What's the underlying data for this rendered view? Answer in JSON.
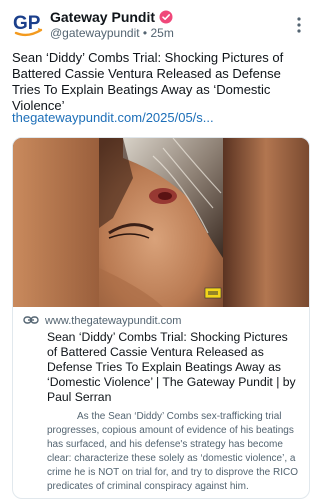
{
  "account": {
    "avatar_text": "GP",
    "display_name": "Gateway Pundit",
    "handle": "@gatewaypundit",
    "separator": "•",
    "time": "25m",
    "verified_color": "#f0487a"
  },
  "post": {
    "text": "Sean ‘Diddy’ Combs Trial: Shocking Pictures of Battered Cassie Ventura Released as Defense Tries To Explain Beatings Away as ‘Domestic Violence’",
    "link": "thegatewaypundit.com/2025/05/s..."
  },
  "card": {
    "domain": "www.thegatewaypundit.com",
    "title": "Sean ‘Diddy’ Combs Trial: Shocking Pictures of Battered Cassie Ventura Released as Defense Tries To Explain Beatings Away as ‘Domestic Violence’ | The Gateway Pundit | by Paul Serran",
    "description": "As the Sean ‘Diddy’ Combs sex-trafficking trial progresses, copious amount of evidence of his beatings has surfaced, and his defense's strategy has become clear: characterize these solely as ‘domestic violence’, a crime he is NOT on trial for, and try to disprove the RICO predicates of criminal conspiracy against him."
  },
  "colors": {
    "brand_blue": "#1b3f8b",
    "brand_orange": "#f39a1e",
    "link": "#1d6fb8",
    "muted": "#536471"
  },
  "icons": {
    "more": "more-vertical-icon",
    "link": "link-icon",
    "verified": "verified-badge-icon"
  }
}
